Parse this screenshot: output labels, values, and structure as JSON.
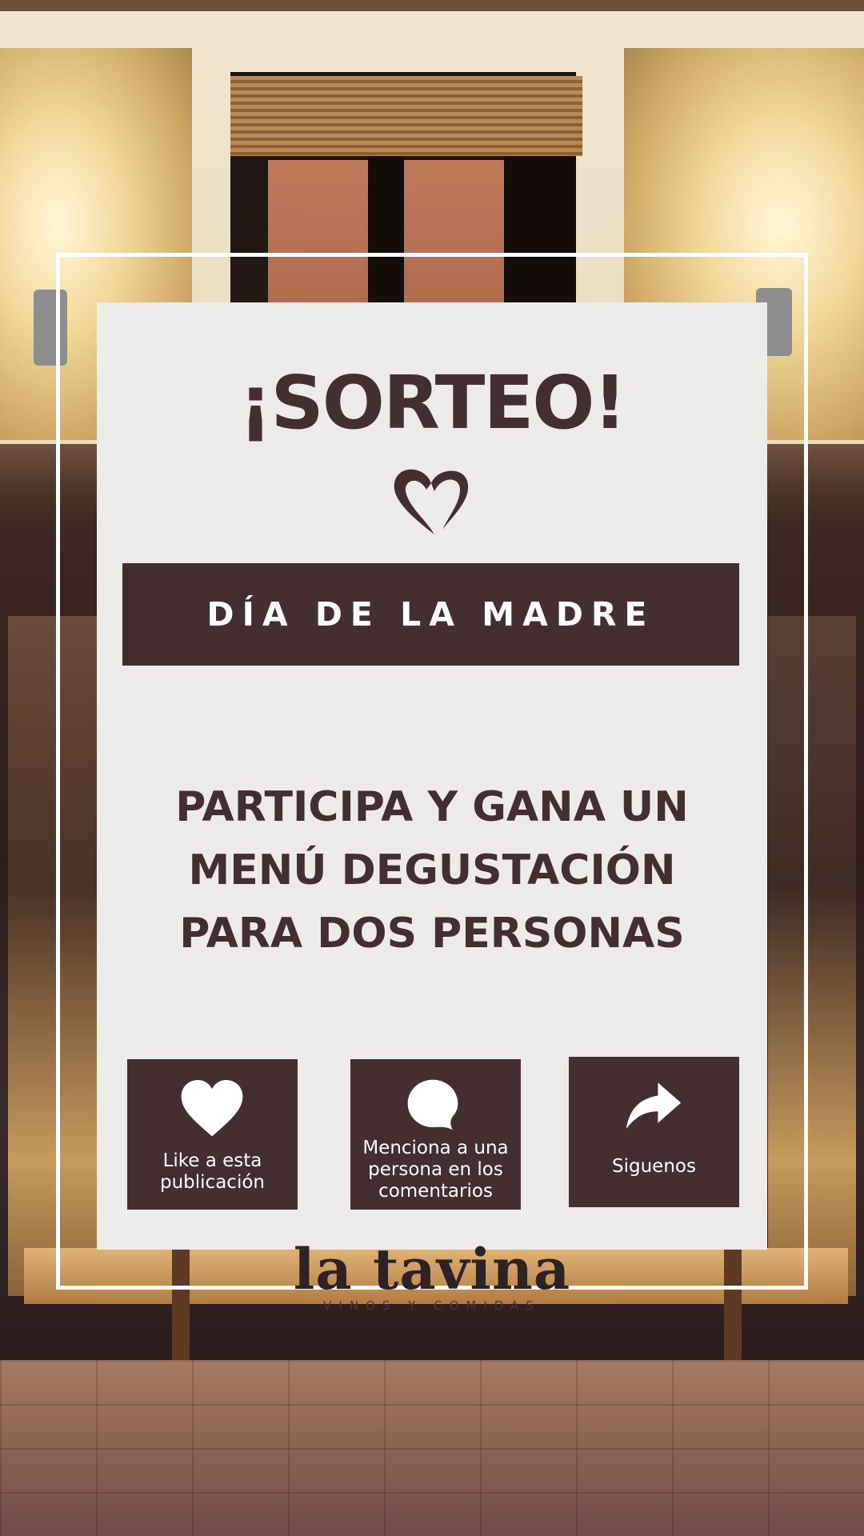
{
  "title": "¡SORTEO!",
  "banner": "DÍA DE LA MADRE",
  "headline": [
    "PARTICIPA Y GANA UN",
    "MENÚ DEGUSTACIÓN",
    "PARA DOS PERSONAS"
  ],
  "actions": [
    {
      "icon": "heart-icon",
      "line1": "Like a esta",
      "line2": "publicación"
    },
    {
      "icon": "speech-bubble-icon",
      "line1": "Menciona a una",
      "line2": "persona en los",
      "line3": "comentarios"
    },
    {
      "icon": "share-arrow-icon",
      "line1": "Siguenos"
    }
  ],
  "logo": {
    "name": "la tavina",
    "tagline": "VINOS Y COMIDAS"
  },
  "colors": {
    "accent": "#432e31",
    "card": "#ecebe9",
    "frame": "#ffffff"
  }
}
